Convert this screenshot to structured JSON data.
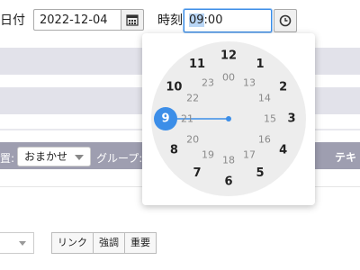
{
  "form": {
    "date_label": "日付",
    "date_value": "2022-12-04",
    "time_label": "時刻",
    "time_hour_selected": "09",
    "time_rest": ":00"
  },
  "toolbar": {
    "position_label": "置:",
    "position_value": "おまかせ",
    "group_label": "グループ:",
    "text_label": "テキ"
  },
  "format_buttons": [
    "リンク",
    "強調",
    "重要"
  ],
  "clock": {
    "selected_hour": "9",
    "outer": [
      "12",
      "1",
      "2",
      "3",
      "4",
      "5",
      "6",
      "7",
      "8",
      "9",
      "10",
      "11"
    ],
    "inner": [
      "00",
      "13",
      "14",
      "15",
      "16",
      "17",
      "18",
      "19",
      "20",
      "21",
      "22",
      "23"
    ],
    "accent_color": "#3c8ee8"
  },
  "icons": {
    "calendar": "calendar-icon",
    "clock": "clock-icon"
  }
}
